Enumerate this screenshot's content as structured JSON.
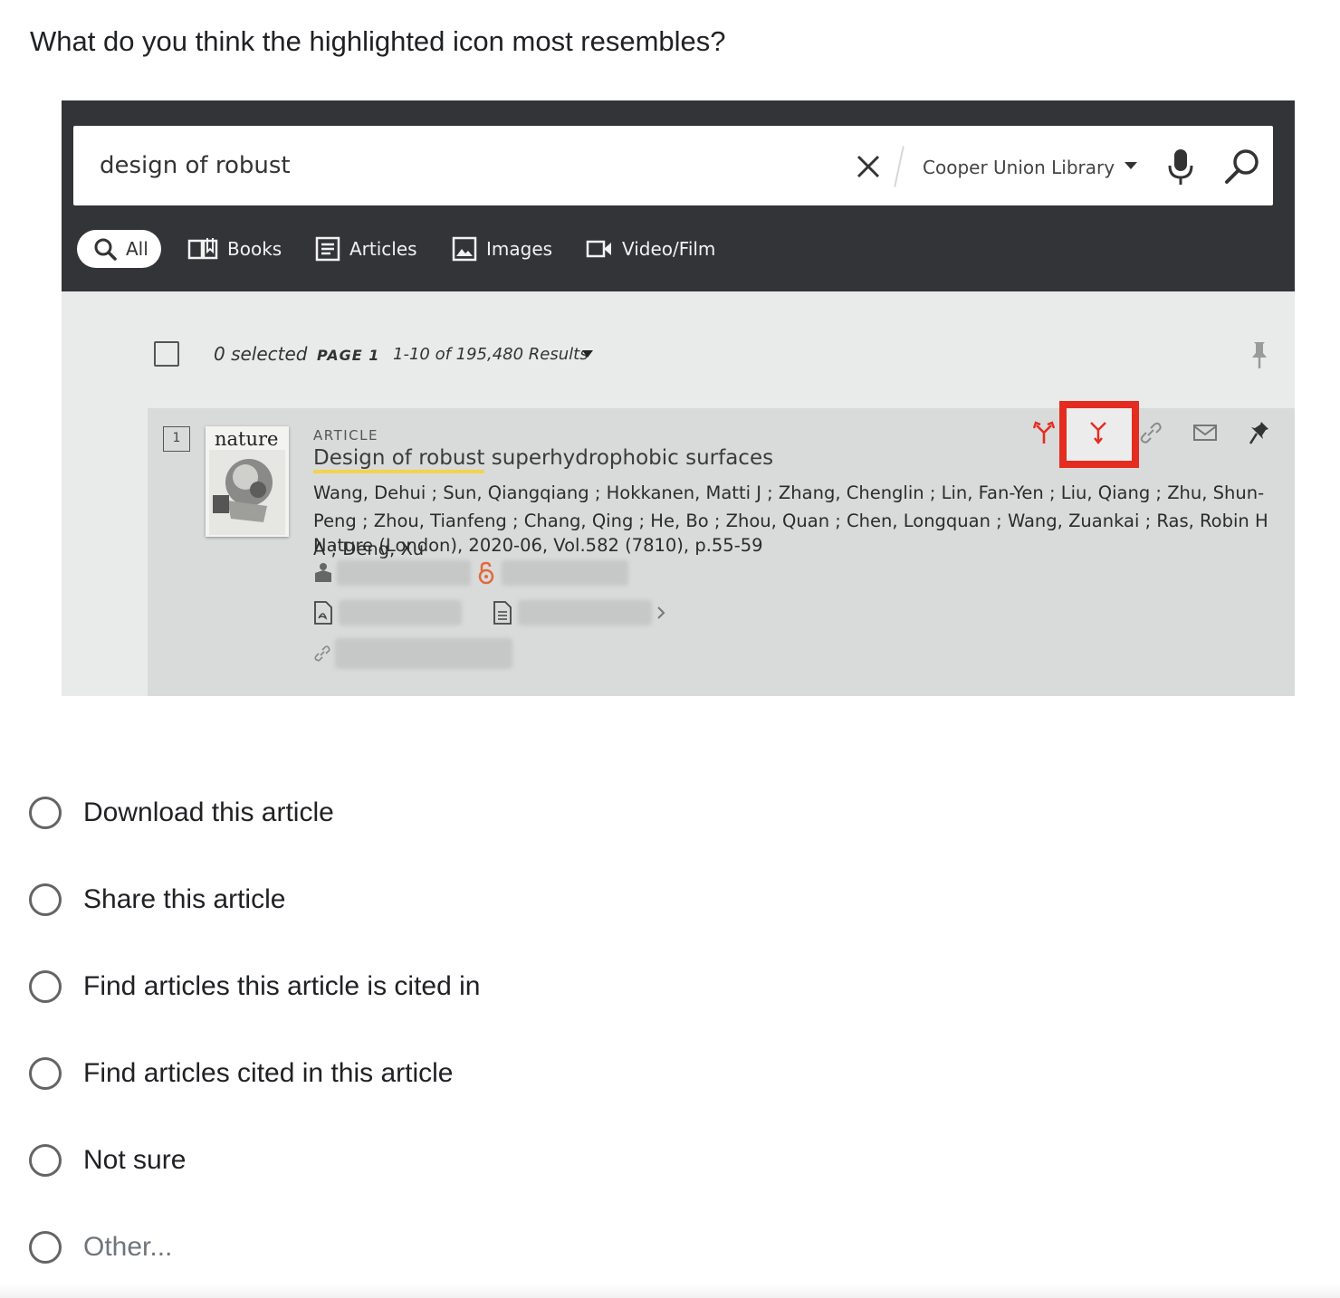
{
  "question": "What do you think the highlighted icon most resembles?",
  "screenshot": {
    "search": {
      "query": "design of robust",
      "scope": "Cooper Union Library"
    },
    "tabs": [
      {
        "label": "All",
        "icon": "search-icon"
      },
      {
        "label": "Books",
        "icon": "book-icon"
      },
      {
        "label": "Articles",
        "icon": "article-icon"
      },
      {
        "label": "Images",
        "icon": "image-icon"
      },
      {
        "label": "Video/Film",
        "icon": "video-icon"
      }
    ],
    "results_bar": {
      "selected": "0 selected",
      "page": "PAGE 1",
      "count": "1-10 of 195,480 Results"
    },
    "result": {
      "rank": "1",
      "thumbnail_title": "nature",
      "type": "ARTICLE",
      "title_highlight": "Design of robust",
      "title_rest": " superhydrophobic surfaces",
      "authors": "Wang, Dehui ; Sun, Qiangqiang ; Hokkanen, Matti J ; Zhang, Chenglin ; Lin, Fan-Yen ; Liu, Qiang ; Zhu, Shun-Peng ; Zhou, Tianfeng ; Chang, Qing ; He, Bo ; Zhou, Quan ; Chen, Longquan ; Wang, Zuankai ; Ras, Robin H A ; Deng, Xu",
      "source": "Nature (London), 2020-06, Vol.582 (7810), p.55-59",
      "action_icons": [
        "citing-articles-icon",
        "cited-articles-icon",
        "link-icon",
        "email-icon",
        "pin-icon"
      ],
      "accent_color": "#e42c20"
    }
  },
  "options": [
    {
      "label": "Download this article"
    },
    {
      "label": "Share this article"
    },
    {
      "label": "Find articles this article is cited in"
    },
    {
      "label": "Find articles cited in this article"
    },
    {
      "label": "Not sure"
    },
    {
      "label": "Other..."
    }
  ]
}
